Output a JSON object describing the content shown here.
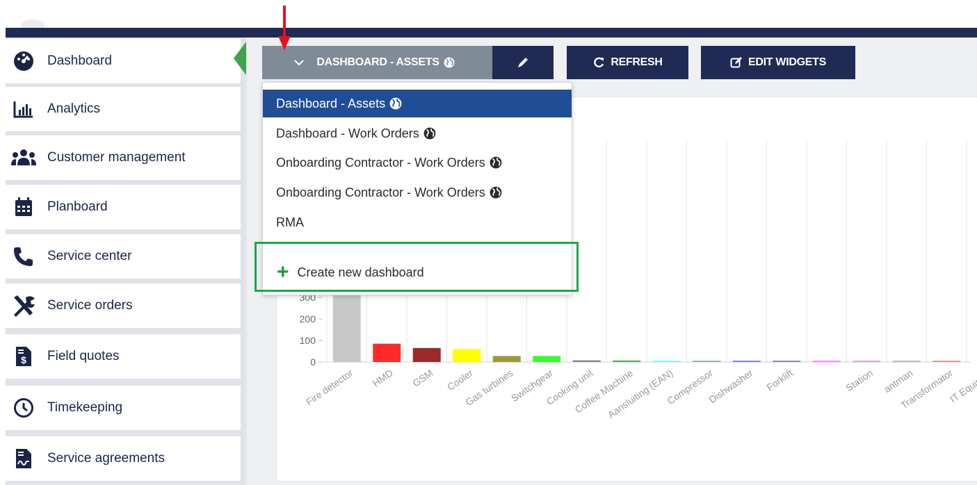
{
  "toolbar": {
    "dashboard_label": "DASHBOARD - ASSETS",
    "refresh_label": "REFRESH",
    "edit_widgets_label": "EDIT WIDGETS"
  },
  "sidebar": {
    "items": [
      {
        "label": "Dashboard",
        "icon": "dashboard-gauge-icon",
        "active": true
      },
      {
        "label": "Analytics",
        "icon": "bar-chart-icon"
      },
      {
        "label": "Customer management",
        "icon": "users-icon"
      },
      {
        "label": "Planboard",
        "icon": "calendar-icon"
      },
      {
        "label": "Service center",
        "icon": "phone-icon"
      },
      {
        "label": "Service orders",
        "icon": "tools-icon"
      },
      {
        "label": "Field quotes",
        "icon": "invoice-icon"
      },
      {
        "label": "Timekeeping",
        "icon": "clock-icon"
      },
      {
        "label": "Service agreements",
        "icon": "contract-icon"
      }
    ]
  },
  "dropdown": {
    "items": [
      {
        "label": "Dashboard - Assets",
        "selected": true
      },
      {
        "label": "Dashboard - Work Orders"
      },
      {
        "label": "Onboarding Contractor - Work Orders"
      },
      {
        "label": "Onboarding Contractor - Work Orders"
      },
      {
        "label": "RMA"
      }
    ],
    "create_label": "Create new dashboard"
  },
  "colors": {
    "navy": "#1f2b55",
    "selected_blue": "#1f4d96",
    "dropdown_button_gray": "#7f8b97",
    "highlight_green": "#1aa84b",
    "active_marker_green": "#3fa34d",
    "annotation_red": "#e3131b"
  },
  "chart_data": {
    "type": "bar",
    "categories": [
      "Fire detector",
      "HMD",
      "GSM",
      "Cooler",
      "Gas turbines",
      "Switchgear",
      "Cooking unit",
      "Coffee Machine",
      "Aansluiting (EAN)",
      "Compressor",
      "Dishwasher",
      "Forklift",
      "",
      "Station",
      "antman",
      "Transformator",
      "IT Equipme"
    ],
    "values": [
      340,
      85,
      65,
      60,
      28,
      28,
      8,
      7,
      5,
      5,
      6,
      5,
      4,
      4,
      4,
      3,
      0
    ],
    "colors": [
      "#c8c8c8",
      "#ff2b2b",
      "#9b2a2a",
      "#ffff00",
      "#9a9a3a",
      "#33ff33",
      "#8a8a8a",
      "#4caf50",
      "#7fffff",
      "#8fbcbc",
      "#7f7fff",
      "#9b7fbf",
      "#ff7fff",
      "#d8a8d8",
      "#c8b0c8",
      "#e89a8a",
      "#cccccc"
    ],
    "y_ticks": [
      0,
      100,
      200,
      300
    ],
    "y_tick_labels": [
      "0",
      "100",
      "200",
      "300"
    ]
  }
}
